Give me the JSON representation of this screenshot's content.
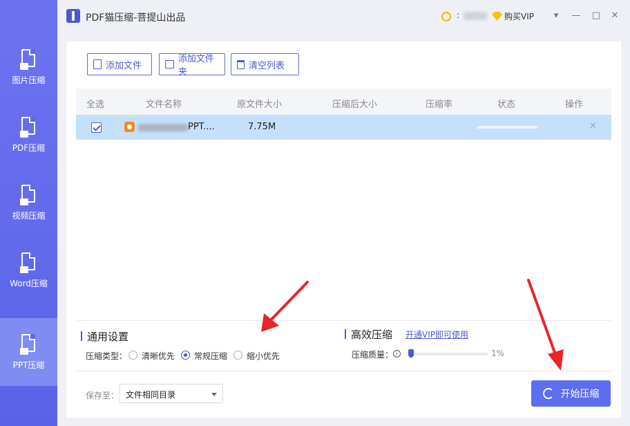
{
  "window": {
    "title": "PDF猫压缩-菩提山出品",
    "user_name": ":",
    "vip_label": "购买VIP",
    "controls": {
      "menu": "▾",
      "minimize": "—",
      "maximize": "□",
      "close": "✕"
    }
  },
  "sidebar": {
    "items": [
      {
        "label": "图片压缩",
        "icon": "image-file-icon",
        "active": false
      },
      {
        "label": "PDF压缩",
        "icon": "pdf-file-icon",
        "active": false
      },
      {
        "label": "视频压缩",
        "icon": "video-file-icon",
        "active": false
      },
      {
        "label": "Word压缩",
        "icon": "word-file-icon",
        "active": false
      },
      {
        "label": "PPT压缩",
        "icon": "ppt-file-icon",
        "active": true
      }
    ]
  },
  "toolbar": {
    "add_file": "添加文件",
    "add_folder": "添加文件夹",
    "clear_list": "清空列表"
  },
  "table": {
    "headers": [
      "全选",
      "文件名称",
      "原文件大小",
      "压缩后大小",
      "压缩率",
      "状态",
      "操作"
    ],
    "rows": [
      {
        "checked": true,
        "name": "PPT....",
        "original_size": "7.75M",
        "compressed_size": "",
        "ratio": "",
        "progress": 0,
        "action": "✕"
      }
    ]
  },
  "settings": {
    "general_title": "通用设置",
    "type_label": "压缩类型：",
    "options": [
      {
        "label": "清晰优先",
        "checked": false
      },
      {
        "label": "常规压缩",
        "checked": true
      },
      {
        "label": "缩小优先",
        "checked": false
      }
    ],
    "efficient_title": "高效压缩",
    "vip_link": "开通VIP即可使用",
    "quality_label": "压缩质量：",
    "quality_value": "1%",
    "quality_level": 0.01
  },
  "footer": {
    "save_to_label": "保存至：",
    "save_to_value": "文件相同目录",
    "start_button": "开始压缩"
  },
  "colors": {
    "sidebar": "#5f68ea",
    "accent": "#4a59d8",
    "button": "#5e6ef0",
    "selected_row": "#c5e0fb",
    "arrow": "#e8252a"
  }
}
